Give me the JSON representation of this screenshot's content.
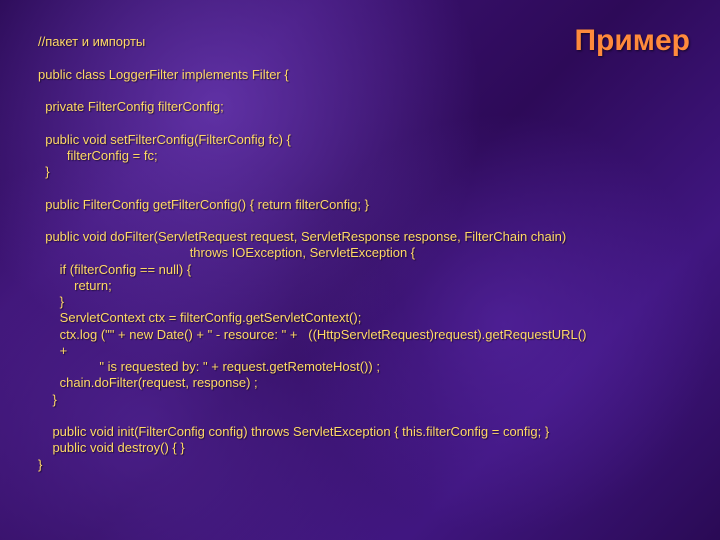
{
  "title": "Пример",
  "code": {
    "l00": "//пакет и импорты",
    "l01": "",
    "l02": "public class LoggerFilter implements Filter {",
    "l03": "",
    "l04": "  private FilterConfig filterConfig;",
    "l05": "",
    "l06": "  public void setFilterConfig(FilterConfig fc) {",
    "l07": "        filterConfig = fc;",
    "l08": "  }",
    "l09": "",
    "l10": "  public FilterConfig getFilterConfig() { return filterConfig; }",
    "l11": "",
    "l12": "  public void doFilter(ServletRequest request, ServletResponse response, FilterChain chain)",
    "l13": "                                          throws IOException, ServletException {",
    "l14": "      if (filterConfig == null) {",
    "l15": "          return;",
    "l16": "      }",
    "l17": "      ServletContext ctx = filterConfig.getServletContext();",
    "l18": "      ctx.log (\"\" + new Date() + \" - resource: \" +   ((HttpServletRequest)request).getRequestURL()",
    "l19": "      +",
    "l20": "                 \" is requested by: \" + request.getRemoteHost()) ;",
    "l21": "      chain.doFilter(request, response) ;",
    "l22": "    }",
    "l23": "",
    "l24": "    public void init(FilterConfig config) throws ServletException { this.filterConfig = config; }",
    "l25": "    public void destroy() { }",
    "l26": "}"
  }
}
